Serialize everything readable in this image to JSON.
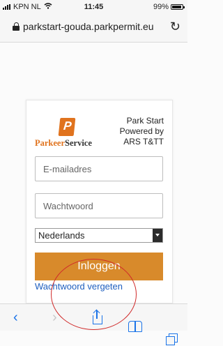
{
  "status_bar": {
    "carrier": "KPN NL",
    "time": "11:45",
    "battery": "99%"
  },
  "browser": {
    "url": "parkstart-gouda.parkpermit.eu",
    "reload_glyph": "↻"
  },
  "login": {
    "logo": {
      "mark_letter": "P",
      "brand_part1": "Parkeer",
      "brand_part2": "Service"
    },
    "powered_by": [
      "Park Start",
      "Powered by",
      "ARS T&TT"
    ],
    "email_placeholder": "E-mailadres",
    "password_placeholder": "Wachtwoord",
    "language": "Nederlands",
    "login_button": "Inloggen",
    "forgot_password": "Wachtwoord vergeten"
  },
  "toolbar": {
    "back_glyph": "‹",
    "forward_glyph": "›"
  },
  "colors": {
    "brand_orange": "#e0731e",
    "login_button": "#d88a2b",
    "link": "#1f5fbf",
    "ios_blue": "#1a73e8",
    "annotation": "#d02a2a"
  },
  "icons": [
    "wifi-icon",
    "lock-icon",
    "reload-icon",
    "chevron-left-icon",
    "chevron-right-icon",
    "share-icon",
    "bookmarks-icon",
    "tabs-icon",
    "select-arrow-icon"
  ]
}
